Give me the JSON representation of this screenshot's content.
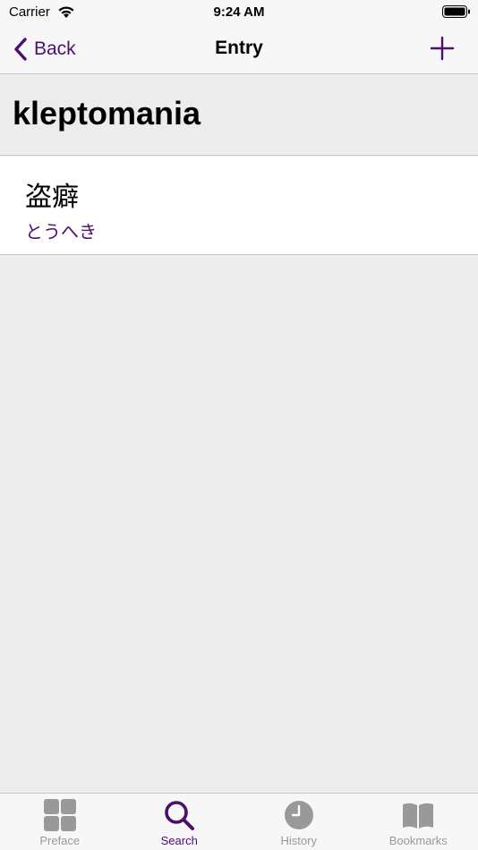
{
  "status_bar": {
    "carrier": "Carrier",
    "time": "9:24 AM"
  },
  "nav": {
    "back_label": "Back",
    "title": "Entry"
  },
  "entry": {
    "headword": "kleptomania",
    "kanji": "盗癖",
    "reading": "とうへき"
  },
  "tabs": [
    {
      "label": "Preface",
      "icon": "grid-icon",
      "active": false
    },
    {
      "label": "Search",
      "icon": "search-icon",
      "active": true
    },
    {
      "label": "History",
      "icon": "clock-icon",
      "active": false
    },
    {
      "label": "Bookmarks",
      "icon": "book-icon",
      "active": false
    }
  ],
  "colors": {
    "accent": "#4b0f6e",
    "inactive": "#999999",
    "background": "#ededed"
  }
}
